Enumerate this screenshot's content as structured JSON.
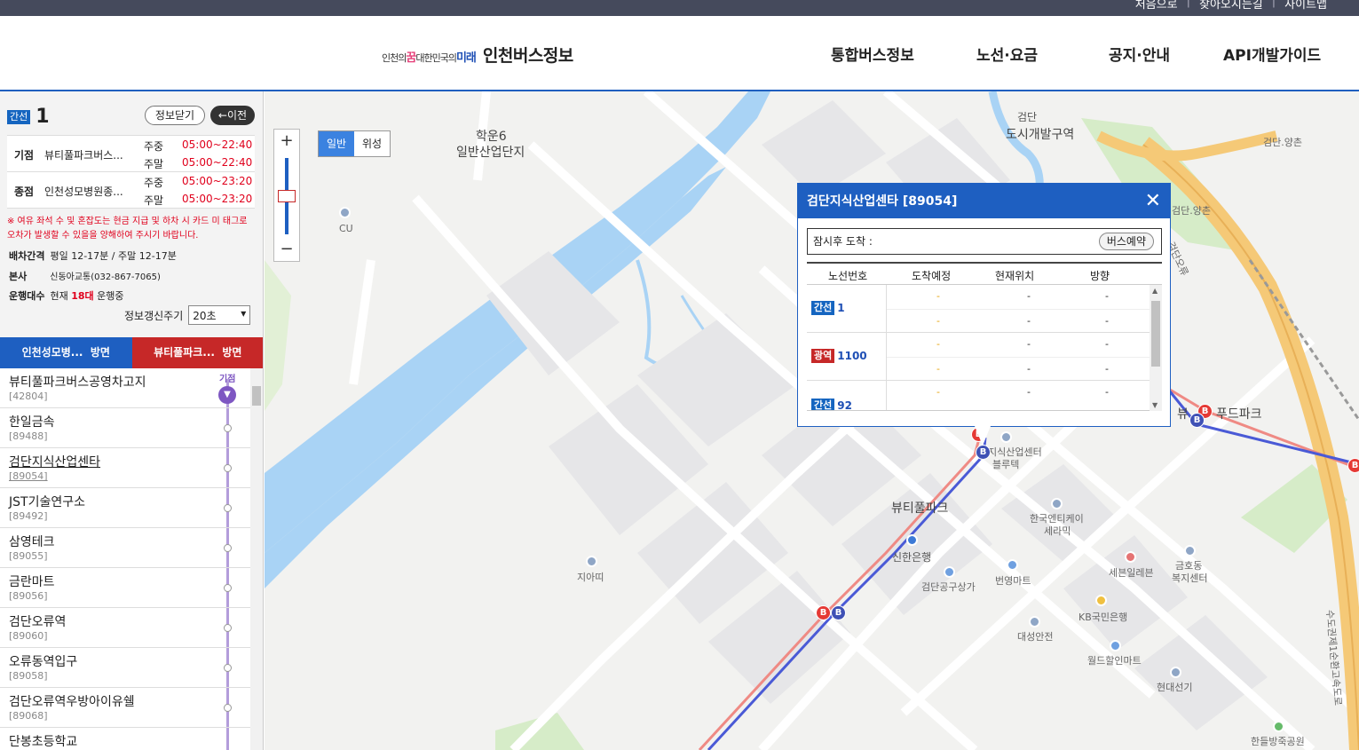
{
  "util_links": [
    "처음으로",
    "찾아오시는길",
    "사이트맵"
  ],
  "logo": {
    "slogan_a": "인천의",
    "slogan_b": "꿈",
    "slogan_c": "대한민국의",
    "slogan_d": "미래",
    "title": "인천버스정보"
  },
  "gnb": [
    "통합버스정보",
    "노선·요금",
    "공지·안내",
    "API개발가이드"
  ],
  "route": {
    "type_badge": "간선",
    "number": "1",
    "close_btn": "정보닫기",
    "prev_btn": "←이전",
    "start": {
      "label": "기점",
      "name": "뷰티풀파크버스...",
      "weekday": "주중",
      "weekday_time": "05:00~22:40",
      "weekend": "주말",
      "weekend_time": "05:00~22:40"
    },
    "end": {
      "label": "종점",
      "name": "인천성모병원종...",
      "weekday": "주중",
      "weekday_time": "05:00~23:20",
      "weekend": "주말",
      "weekend_time": "05:00~23:20"
    },
    "notice": "※ 여유 좌석 수 및 혼잡도는 현금 지급 및 하차 시 카드 미 태그로 오차가 발생할 수 있을을 양해하여 주시기 바랍니다.",
    "interval_label": "배차간격",
    "interval_value": "평일 12-17분 / 주말 12-17분",
    "office_label": "본사",
    "office_value": "신동아교통(032-867-7065)",
    "fleet_label": "운행대수",
    "fleet_prefix": "현재",
    "fleet_count": "18대",
    "fleet_suffix": "운행중",
    "refresh_label": "정보갱신주기",
    "refresh_value": "20초"
  },
  "directions": [
    {
      "name": "인천성모병...",
      "suffix": "방면"
    },
    {
      "name": "뷰티풀파크...",
      "suffix": "방면"
    }
  ],
  "start_mark_label": "기점",
  "stops": [
    {
      "name": "뷰티풀파크버스공영차고지",
      "id": "[42804]"
    },
    {
      "name": "한일금속",
      "id": "[89488]"
    },
    {
      "name": "검단지식산업센타",
      "id": "[89054]"
    },
    {
      "name": "JST기술연구소",
      "id": "[89492]"
    },
    {
      "name": "삼영테크",
      "id": "[89055]"
    },
    {
      "name": "금란마트",
      "id": "[89056]"
    },
    {
      "name": "검단오류역",
      "id": "[89060]"
    },
    {
      "name": "오류동역입구",
      "id": "[89058]"
    },
    {
      "name": "검단오류역우방아이유쉘",
      "id": "[89068]"
    },
    {
      "name": "단봉초등학교",
      "id": ""
    }
  ],
  "map": {
    "zoom_in": "+",
    "zoom_out": "−",
    "type_normal": "일반",
    "type_satellite": "위성",
    "labels": {
      "l1": "학운6",
      "l2": "일반산업단지",
      "l3": "도시개발구역",
      "l4": "CU",
      "l5": "검단.양촌",
      "l6": "검단.양촌",
      "l7": "뷰티풀파크",
      "l8": "한국엔티케이",
      "l9": "세라믹",
      "l10": "신한은행",
      "l11": "지아띠",
      "l12": "검단공구상가",
      "l13": "번영마트",
      "l14": "세븐일레븐",
      "l15": "금호동",
      "l16": "복지센터",
      "l17": "KB국민은행",
      "l18": "대성안전",
      "l19": "월드할인마트",
      "l20": "현대선기",
      "l21": "한들방죽공원",
      "l22": "지식산업센터",
      "l23": "블루텍",
      "l24": "뷰",
      "l25": "푸드파크",
      "l26": "검단오류",
      "l27": "수도권제1순환고속도로",
      "l28": "검단"
    },
    "bus_marker_letter": "B"
  },
  "popup": {
    "title": "검단지식산업센타 [89054]",
    "close": "✕",
    "arrival_text": "잠시후 도착 :",
    "reserve_btn": "버스예약",
    "headers": [
      "노선번호",
      "도착예정",
      "현재위치",
      "방향"
    ],
    "rows": [
      {
        "badge": "간선",
        "badge_color": "#1565c0",
        "route": "1",
        "cells": [
          [
            "-",
            "-",
            "-"
          ],
          [
            "-",
            "-",
            "-"
          ]
        ]
      },
      {
        "badge": "광역",
        "badge_color": "#c62828",
        "route": "1100",
        "cells": [
          [
            "-",
            "-",
            "-"
          ],
          [
            "-",
            "-",
            "-"
          ]
        ]
      },
      {
        "badge": "간선",
        "badge_color": "#1565c0",
        "route": "92",
        "cells": [
          [
            "-",
            "-",
            "-"
          ],
          [
            "-",
            "-",
            "-"
          ]
        ]
      }
    ]
  }
}
